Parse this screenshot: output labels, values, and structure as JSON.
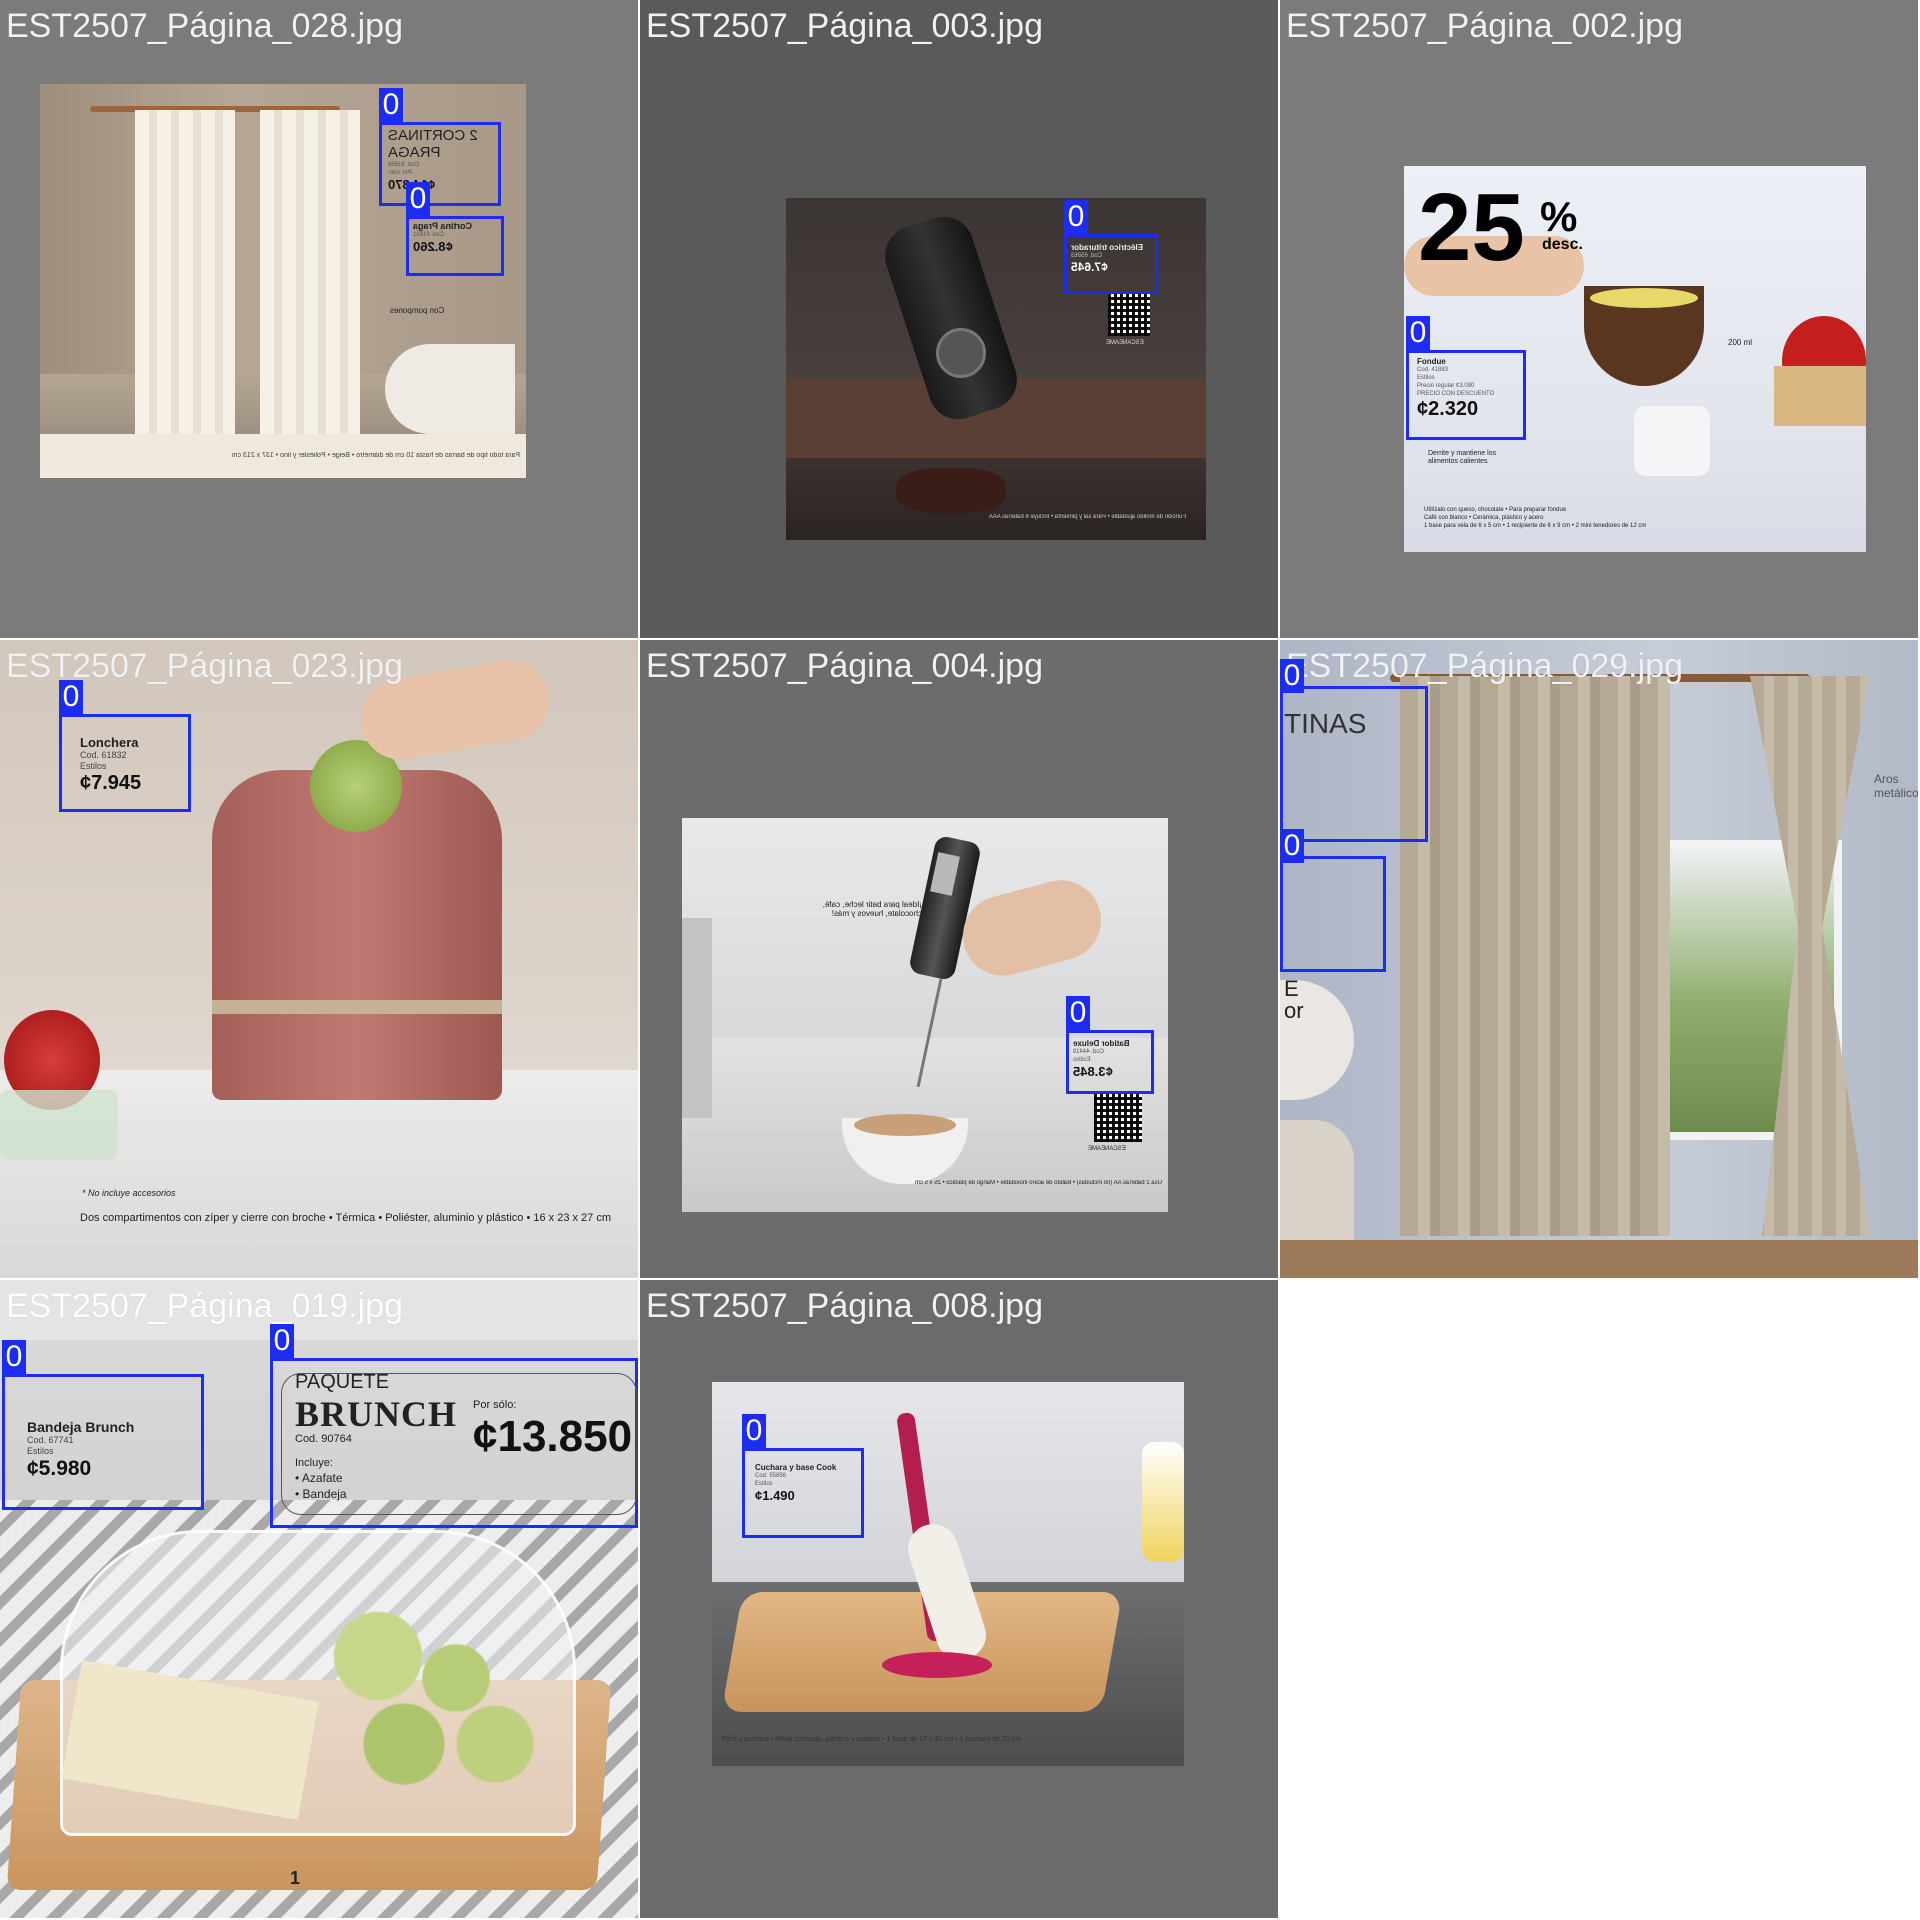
{
  "cells": [
    {
      "filename": "EST2507_Página_028.jpg",
      "boxes": [
        {
          "id": "0"
        },
        {
          "id": "0"
        }
      ],
      "texts": {
        "title": "2 CORTINAS PRAGA",
        "code": "Cod. 91856",
        "price_label": "Por sólo:",
        "price": "¢14.870",
        "item2": "Cortina Praga",
        "item2_code": "Cod. 61621",
        "item2_price": "¢8.260",
        "badge": "Con pompones",
        "footer": "Para todo tipo de barras de hasta 10 cm de diámetro  •  Beige  •  Poliéster y lino  •  137 x 213 cm"
      }
    },
    {
      "filename": "EST2507_Página_003.jpg",
      "boxes": [
        {
          "id": "0"
        }
      ],
      "texts": {
        "name": "Eléctrico triturador",
        "code": "Cod. 65863",
        "price": "¢7.645",
        "scan": "ESCANÉAME",
        "footer": "Función de molido ajustable  •  Para sal y pimienta  •  Incluye 6 baterías AAA"
      }
    },
    {
      "filename": "EST2507_Página_002.jpg",
      "boxes": [
        {
          "id": "0"
        }
      ],
      "texts": {
        "discount": "25",
        "percent": "%",
        "desc": "desc.",
        "name": "Fondue",
        "code": "Cod. 41883",
        "estilo": "Estilos",
        "regular": "Precio regular ¢3.090",
        "promo": "PRECIO CON DESCUENTO",
        "price": "¢2.320",
        "note": "Derrite y mantiene los alimentos calientes",
        "capacity": "200 ml",
        "footer1": "Utilízalo con queso, chocolate  •  Para preparar fondue",
        "footer2": "Café con blanco  •  Cerámica, plástico y acero",
        "footer3": "1 base para vela de 6 x 5 cm  •  1 recipiente de 6 x 9 cm  •  2 mini tenedores de 12 cm"
      }
    },
    {
      "filename": "EST2507_Página_023.jpg",
      "boxes": [
        {
          "id": "0"
        }
      ],
      "texts": {
        "name": "Lonchera",
        "code": "Cod. 61832",
        "estilo": "Estilos",
        "price": "¢7.945",
        "note": "* No incluye accesorios",
        "footer": "Dos compartimentos con zíper y cierre con broche  •  Térmica  •  Poliéster, aluminio y plástico  •  16 x 23 x 27 cm"
      }
    },
    {
      "filename": "EST2507_Página_004.jpg",
      "boxes": [
        {
          "id": "0"
        }
      ],
      "texts": {
        "name": "Batidor Deluxe",
        "code": "Cod. 44419",
        "estilo": "Estilos",
        "price": "¢3.845",
        "scan": "ESCANÉAME",
        "side": "¡Ideal para batir leche, café, chocolate, huevos y más!",
        "footer": "Usa 2 baterías AA (no incluidas)  •  Batido de acero inoxidable  •  Mango de plástico  •  25 x 5 cm"
      }
    },
    {
      "filename": "EST2507_Página_029.jpg",
      "boxes": [
        {
          "id": "0"
        },
        {
          "id": "0"
        }
      ],
      "texts": {
        "title": "TINAS",
        "fragment1": "E",
        "fragment2": "or",
        "side": "Aros metálicos"
      }
    },
    {
      "filename": "EST2507_Página_019.jpg",
      "boxes": [
        {
          "id": "0"
        },
        {
          "id": "0"
        }
      ],
      "texts": {
        "name": "Bandeja Brunch",
        "code": "Cod. 67741",
        "estilo": "Estilos",
        "price": "¢5.980",
        "pack_top": "PAQUETE",
        "pack_title": "BRUNCH",
        "pack_code": "Cod. 90764",
        "pack_label": "Por sólo:",
        "pack_price": "¢13.850",
        "includes": "Incluye:",
        "inc1": "Azafate",
        "inc2": "Bandeja",
        "page": "1"
      }
    },
    {
      "filename": "EST2507_Página_008.jpg",
      "boxes": [
        {
          "id": "0"
        }
      ],
      "texts": {
        "name": "Cuchara y base Cook",
        "code": "Cod. 55856",
        "estilo": "Estilos",
        "price": "¢1.490",
        "footer": "Fácil y práctico  •  Metal cromado, plástico y madera  •  1 base de 17 x 10 cm  •  1 cuchara de 22 cm"
      }
    }
  ]
}
